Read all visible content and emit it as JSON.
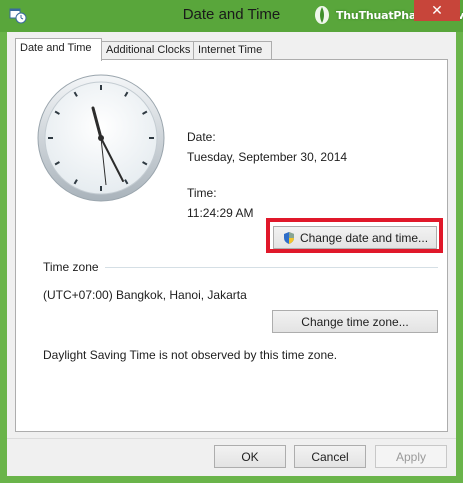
{
  "window": {
    "title": "Date and Time",
    "close_symbol": "✕",
    "watermark_text": "ThuThuatPhanMem.vn",
    "colors": {
      "frame": "#6ab44a",
      "close": "#c7453a",
      "highlight": "#e0182a"
    }
  },
  "tabs": [
    {
      "label": "Date and Time",
      "active": true
    },
    {
      "label": "Additional Clocks",
      "active": false
    },
    {
      "label": "Internet Time",
      "active": false
    }
  ],
  "datetime": {
    "date_label": "Date:",
    "date_value": "Tuesday, September 30, 2014",
    "time_label": "Time:",
    "time_value": "11:24:29 AM",
    "change_button": "Change date and time..."
  },
  "timezone": {
    "section_label": "Time zone",
    "value": "(UTC+07:00) Bangkok, Hanoi, Jakarta",
    "change_button": "Change time zone...",
    "dst_note": "Daylight Saving Time is not observed by this time zone."
  },
  "footer": {
    "ok": "OK",
    "cancel": "Cancel",
    "apply": "Apply"
  }
}
